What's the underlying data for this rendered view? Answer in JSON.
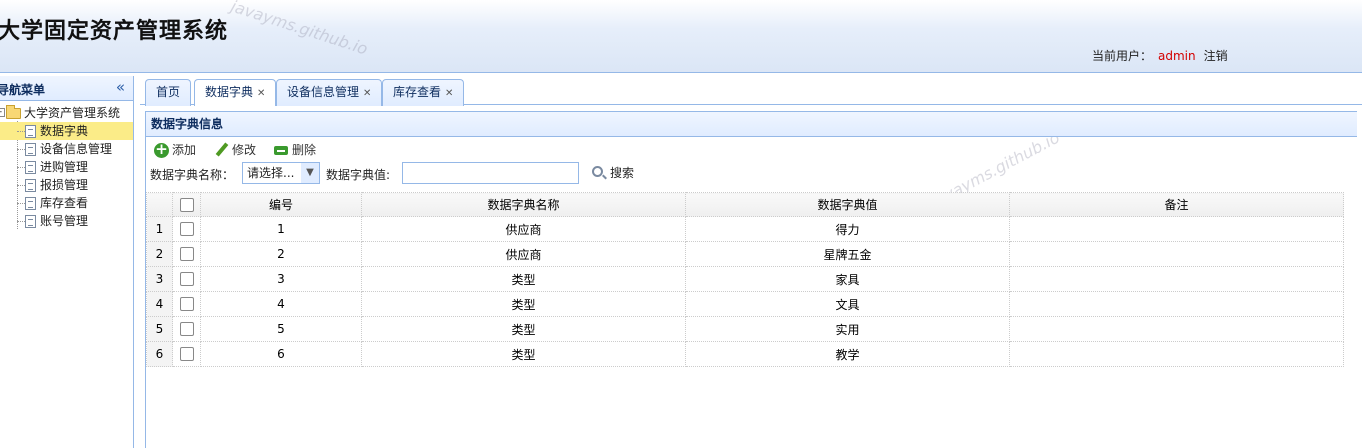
{
  "app": {
    "title": "大学固定资产管理系统",
    "watermark": "javayms.github.io",
    "current_user_label": "当前用户：",
    "current_user": "admin",
    "logout": "注销"
  },
  "sidebar": {
    "title": "导航菜单",
    "collapse_icon": "«",
    "root": "大学资产管理系统",
    "items": [
      {
        "label": "数据字典",
        "selected": true
      },
      {
        "label": "设备信息管理",
        "selected": false
      },
      {
        "label": "进购管理",
        "selected": false
      },
      {
        "label": "报损管理",
        "selected": false
      },
      {
        "label": "库存查看",
        "selected": false
      },
      {
        "label": "账号管理",
        "selected": false
      }
    ]
  },
  "tabs": [
    {
      "label": "首页",
      "closable": false,
      "active": false
    },
    {
      "label": "数据字典",
      "closable": true,
      "active": true
    },
    {
      "label": "设备信息管理",
      "closable": true,
      "active": false
    },
    {
      "label": "库存查看",
      "closable": true,
      "active": false
    }
  ],
  "panel": {
    "title": "数据字典信息",
    "toolbar": {
      "add": "添加",
      "edit": "修改",
      "delete": "删除"
    },
    "search": {
      "name_label": "数据字典名称：",
      "name_select": "请选择...",
      "value_label": "数据字典值:",
      "value_input": "",
      "search_button": "搜索"
    }
  },
  "grid": {
    "columns": [
      "编号",
      "数据字典名称",
      "数据字典值",
      "备注"
    ],
    "rows": [
      {
        "rn": "1",
        "id": "1",
        "name": "供应商",
        "value": "得力",
        "remark": ""
      },
      {
        "rn": "2",
        "id": "2",
        "name": "供应商",
        "value": "星牌五金",
        "remark": ""
      },
      {
        "rn": "3",
        "id": "3",
        "name": "类型",
        "value": "家具",
        "remark": ""
      },
      {
        "rn": "4",
        "id": "4",
        "name": "类型",
        "value": "文具",
        "remark": ""
      },
      {
        "rn": "5",
        "id": "5",
        "name": "类型",
        "value": "实用",
        "remark": ""
      },
      {
        "rn": "6",
        "id": "6",
        "name": "类型",
        "value": "教学",
        "remark": ""
      }
    ]
  },
  "colors": {
    "accent_border": "#95b8e7",
    "selected_node": "#fbec88",
    "username": "#d30000"
  }
}
